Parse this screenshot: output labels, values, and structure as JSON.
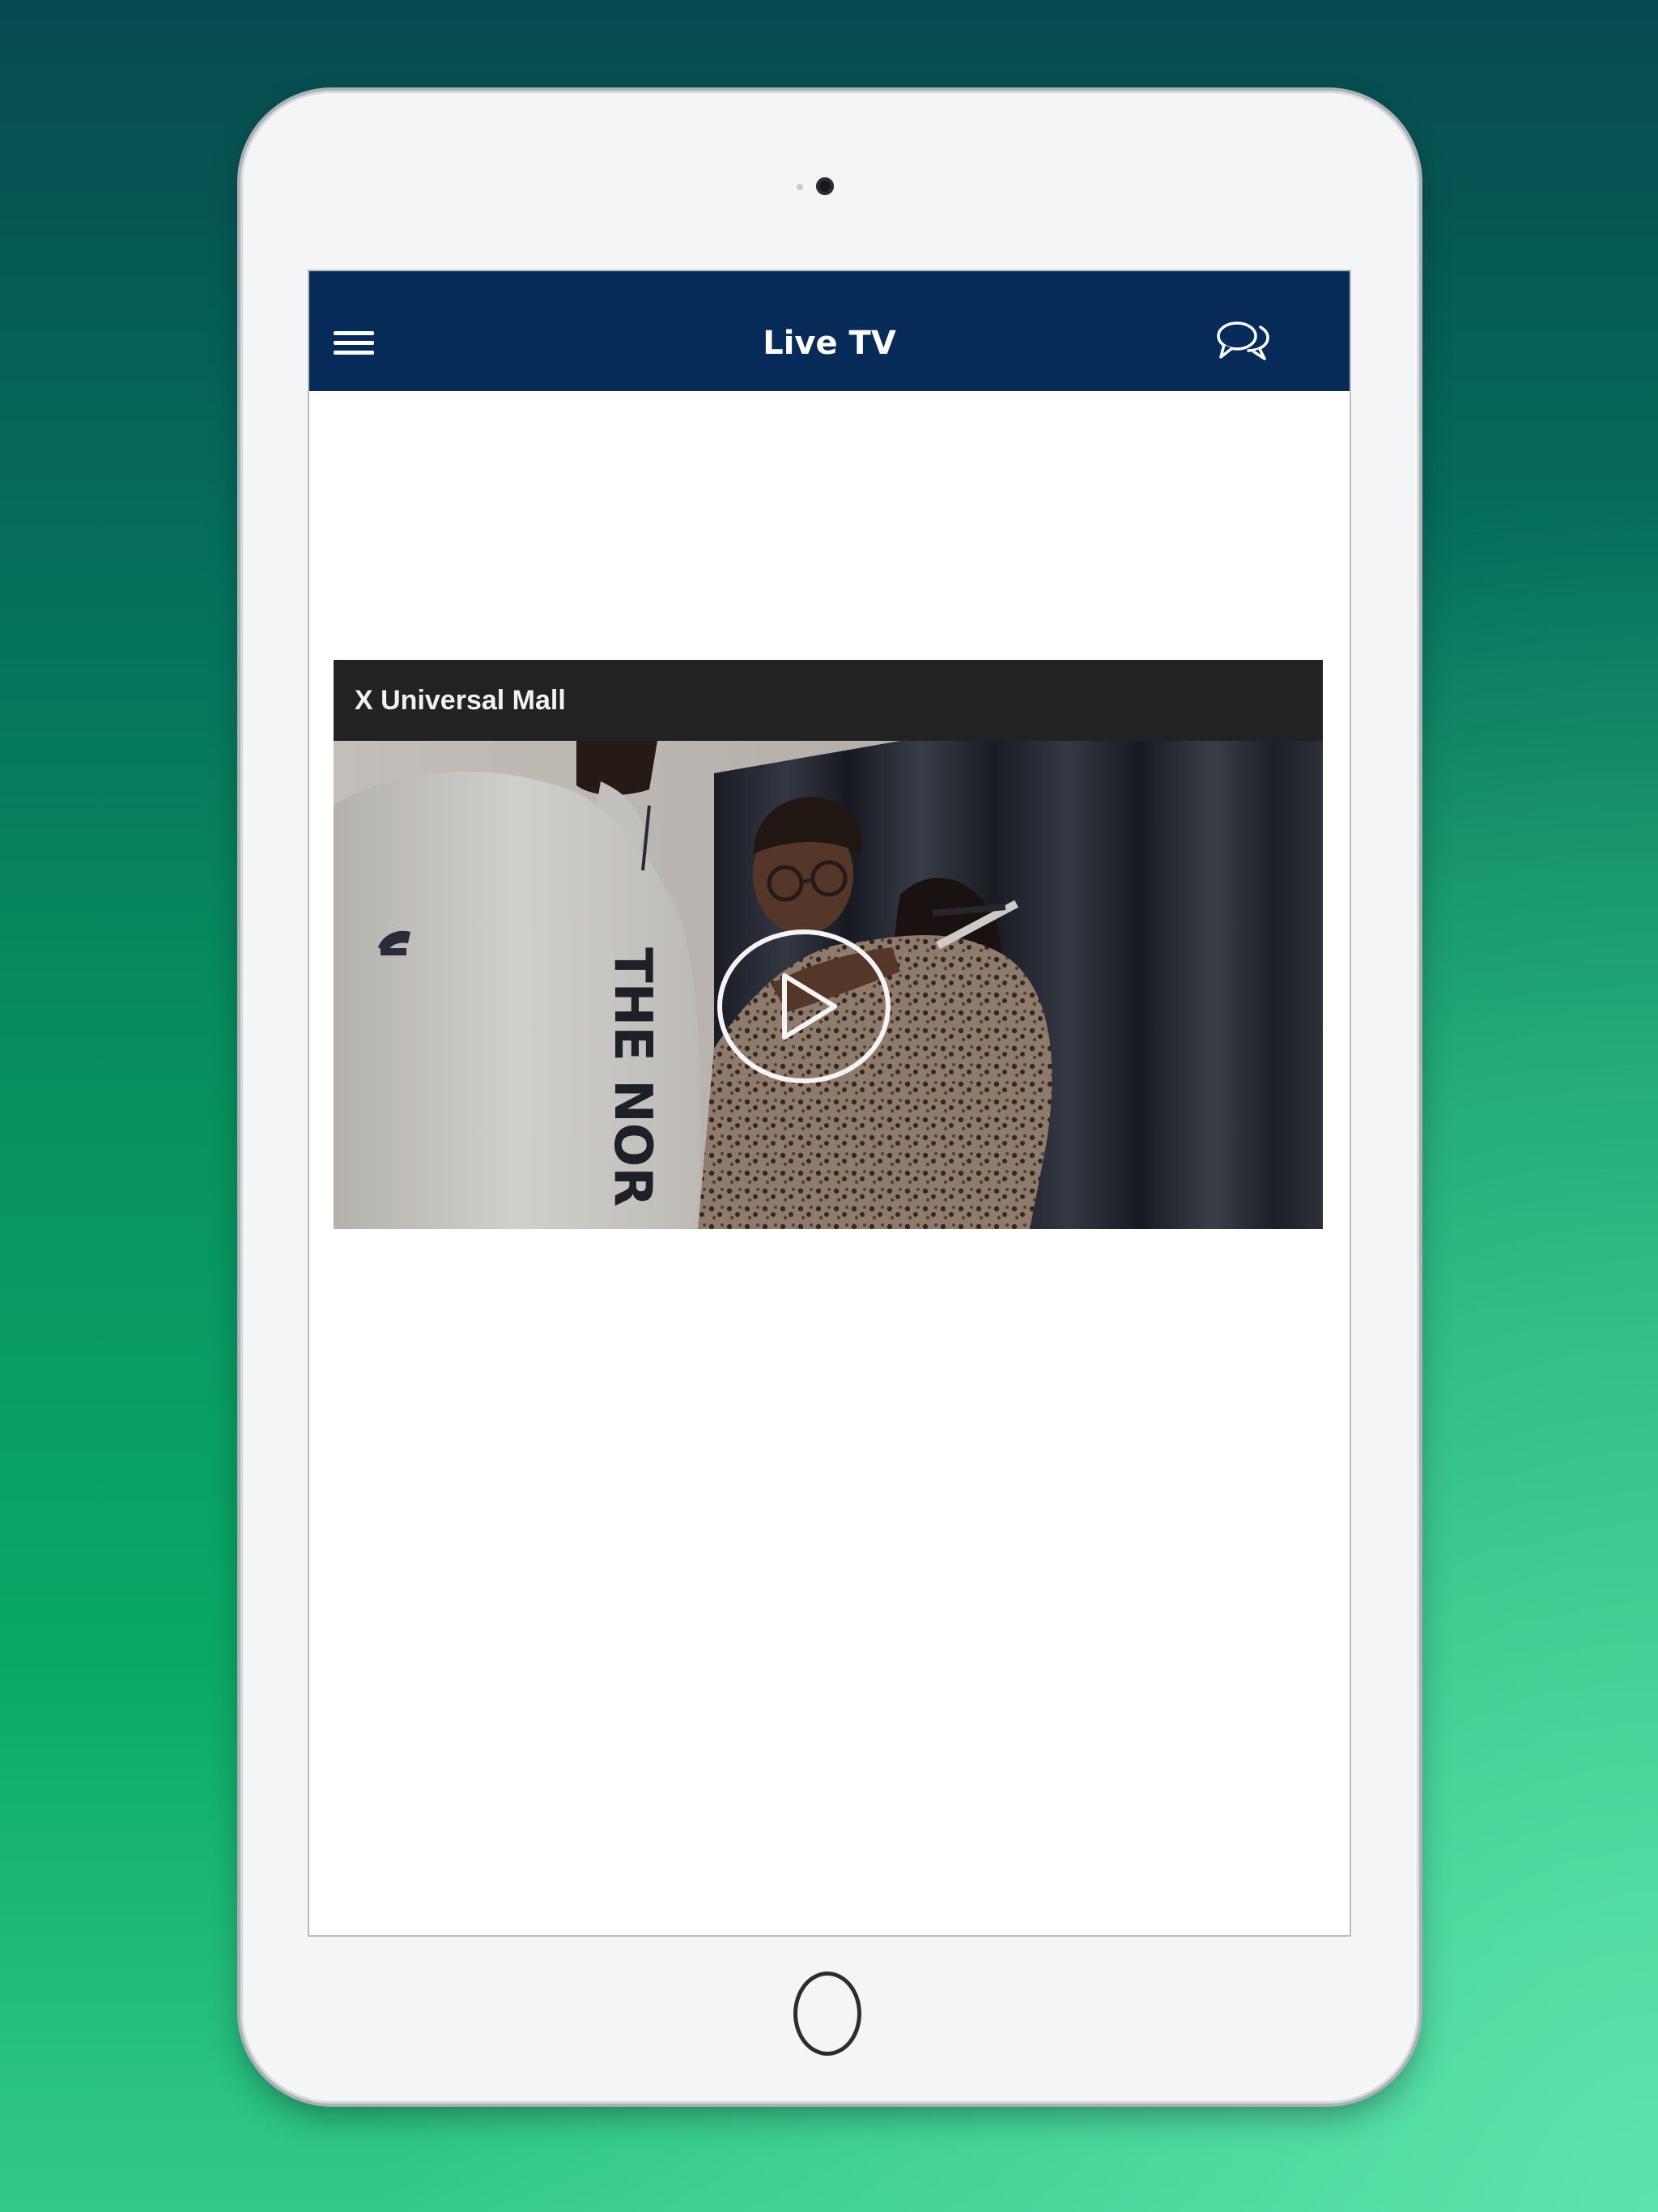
{
  "app": {
    "title": "Live TV",
    "header_color": "#062b58",
    "menu_icon": "hamburger-menu-icon",
    "chat_icon": "chat-bubbles-icon"
  },
  "video": {
    "title": "X Universal Mall",
    "overlay_icon": "play-icon",
    "jacket_text": "THE NOR"
  }
}
